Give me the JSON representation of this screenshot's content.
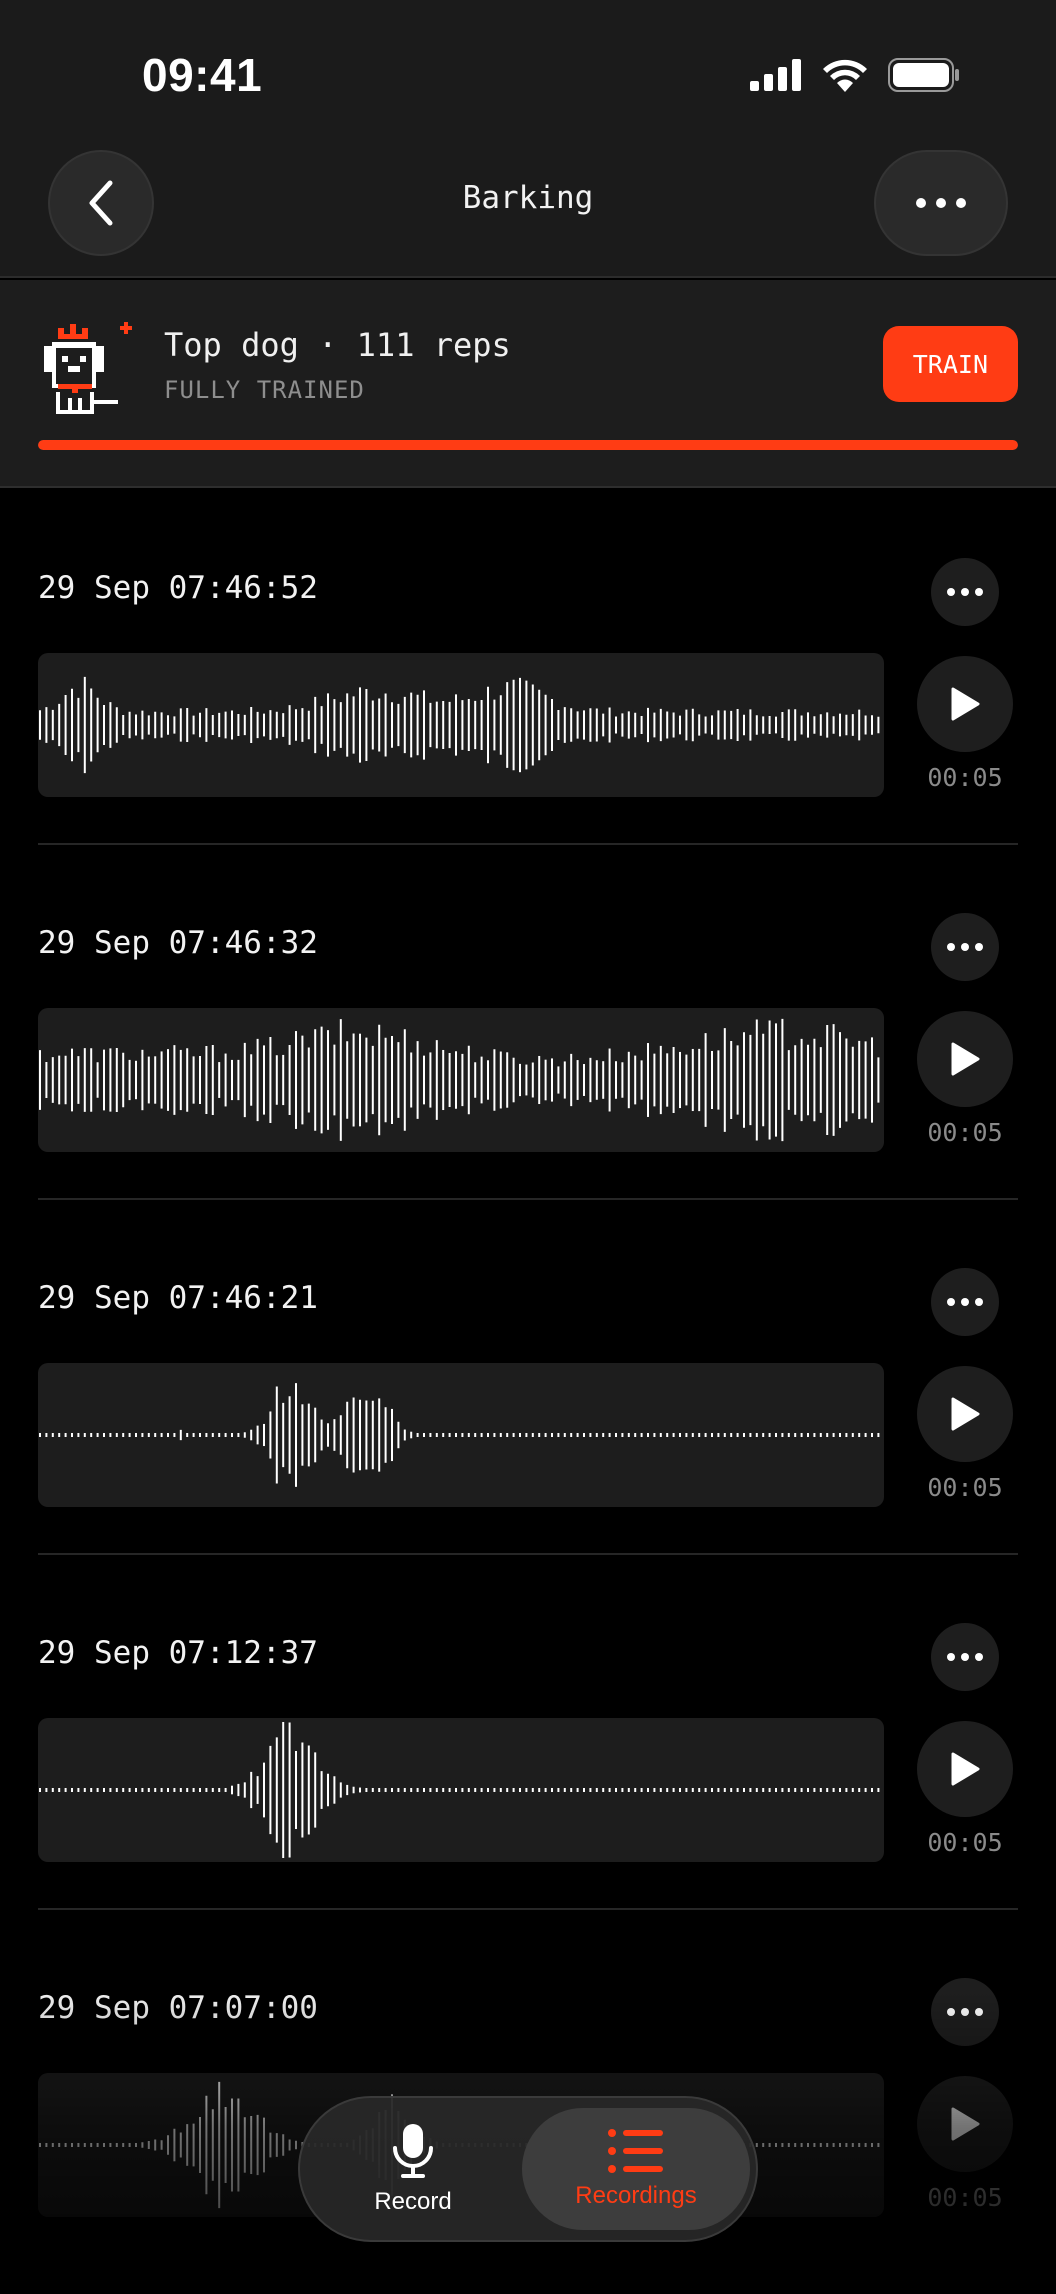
{
  "status": {
    "time": "09:41"
  },
  "header": {
    "title": "Barking"
  },
  "banner": {
    "title": "Top dog · 111 reps",
    "subtitle": "FULLY TRAINED",
    "train_label": "TRAIN",
    "progress": 1.0
  },
  "recordings": [
    {
      "date": "29 Sep 07:46:52",
      "duration": "00:05"
    },
    {
      "date": "29 Sep 07:46:32",
      "duration": "00:05"
    },
    {
      "date": "29 Sep 07:46:21",
      "duration": "00:05"
    },
    {
      "date": "29 Sep 07:12:37",
      "duration": "00:05"
    },
    {
      "date": "29 Sep 07:07:00",
      "duration": "00:05"
    }
  ],
  "tabs": {
    "record_label": "Record",
    "recordings_label": "Recordings"
  },
  "colors": {
    "accent": "#ff3c14",
    "background": "#000000",
    "surface": "#1d1d1d"
  },
  "icons": [
    "back-chevron-icon",
    "more-dots-icon",
    "play-icon",
    "microphone-icon",
    "list-icon",
    "signal-icon",
    "wifi-icon",
    "battery-icon",
    "dog-avatar-icon"
  ]
}
